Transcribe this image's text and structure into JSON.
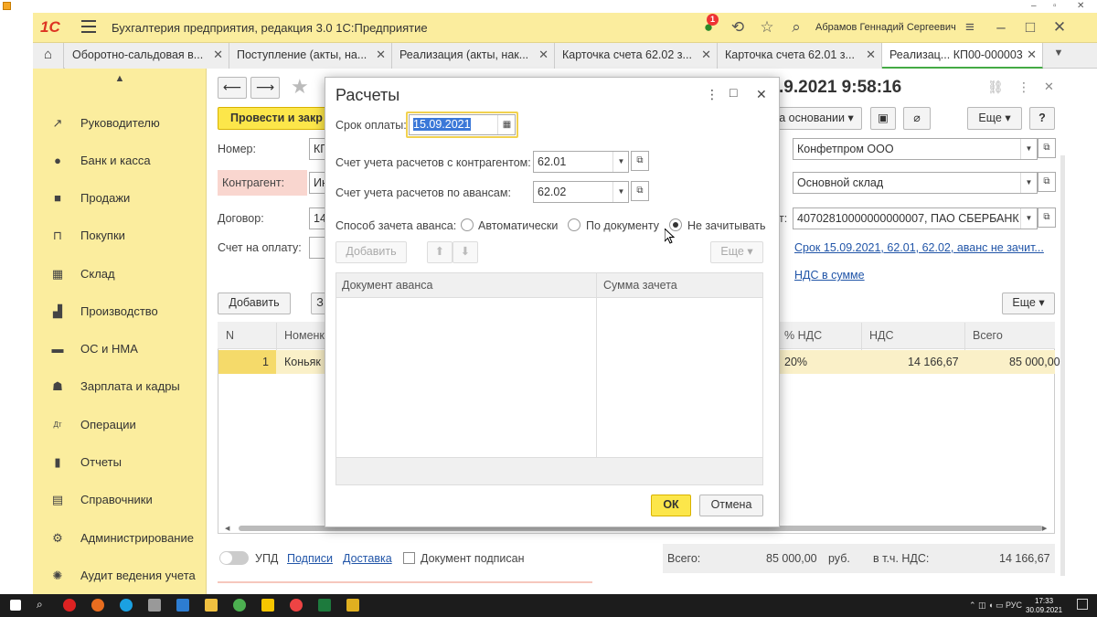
{
  "app": {
    "title": "Бухгалтерия предприятия, редакция 3.0 1С:Предприятие",
    "logo": "1С",
    "user": "Абрамов Геннадий Сергеевич",
    "notifications": "1"
  },
  "tabs": [
    {
      "label": "Оборотно-сальдовая в..."
    },
    {
      "label": "Поступление (акты, на..."
    },
    {
      "label": "Реализация (акты, нак..."
    },
    {
      "label": "Карточка счета 62.02 з..."
    },
    {
      "label": "Карточка счета 62.01 з..."
    },
    {
      "label": "Реализац...  КП00-000003"
    }
  ],
  "sidebar": {
    "items": [
      {
        "label": "Руководителю",
        "icon": "chart-icon"
      },
      {
        "label": "Банк и касса",
        "icon": "coin-icon"
      },
      {
        "label": "Продажи",
        "icon": "bag-icon"
      },
      {
        "label": "Покупки",
        "icon": "cart-icon"
      },
      {
        "label": "Склад",
        "icon": "warehouse-icon"
      },
      {
        "label": "Производство",
        "icon": "factory-icon"
      },
      {
        "label": "ОС и НМА",
        "icon": "truck-icon"
      },
      {
        "label": "Зарплата и кадры",
        "icon": "person-icon"
      },
      {
        "label": "Операции",
        "icon": "dt-kt-icon"
      },
      {
        "label": "Отчеты",
        "icon": "bar-chart-icon"
      },
      {
        "label": "Справочники",
        "icon": "book-icon"
      },
      {
        "label": "Администрирование",
        "icon": "gear-icon"
      },
      {
        "label": "Аудит ведения учета",
        "icon": "audit-icon"
      }
    ]
  },
  "document": {
    "title": ".9.2021 9:58:16",
    "post_close": "Провести и закр",
    "based_on": "а основании",
    "more": "Еще",
    "help": "?",
    "labels": {
      "number": "Номер:",
      "counterparty": "Контрагент:",
      "contract": "Договор:",
      "invoice": "Счет на оплату:",
      "bank_account_suffix": "т:"
    },
    "values": {
      "number": "КП",
      "counterparty": "Ин",
      "contract": "14",
      "organization": "Конфетпром ООО",
      "warehouse": "Основной склад",
      "bank_account": "40702810000000000007, ПАО СБЕРБАНК"
    },
    "links": {
      "settlement": "Срок 15.09.2021, 62.01, 62.02, аванс не зачит...",
      "vat": "НДС в сумме"
    },
    "add": "Добавить",
    "add2": "З",
    "grid": {
      "headers": [
        "N",
        "Номенк",
        "% НДС",
        "НДС",
        "Всего"
      ],
      "row": {
        "n": "1",
        "item": "Коньяк",
        "vat_rate": "20%",
        "vat": "14 166,67",
        "total": "85 000,00"
      }
    },
    "footer": {
      "upd": "УПД",
      "signatures": "Подписи",
      "delivery": "Доставка",
      "signed": "Документ подписан",
      "total_label": "Всего:",
      "total_value": "85 000,00",
      "currency": "руб.",
      "vat_label": "в т.ч. НДС:",
      "vat_value": "14 166,67"
    }
  },
  "modal": {
    "title": "Расчеты",
    "due_label": "Срок оплаты:",
    "due_value": "15.09.2021",
    "acc_label": "Счет учета расчетов с контрагентом:",
    "acc_value": "62.01",
    "adv_label": "Счет учета расчетов по авансам:",
    "adv_value": "62.02",
    "offset_label": "Способ зачета аванса:",
    "radio": [
      {
        "label": "Автоматически",
        "selected": false
      },
      {
        "label": "По документу",
        "selected": false
      },
      {
        "label": "Не зачитывать",
        "selected": true
      }
    ],
    "add": "Добавить",
    "more": "Еще",
    "grid_headers": [
      "Документ аванса",
      "Сумма зачета"
    ],
    "ok": "ОК",
    "cancel": "Отмена"
  },
  "taskbar": {
    "time": "17:33",
    "date": "30.09.2021",
    "lang": "РУС"
  },
  "colors": {
    "panel": "#fbed9e",
    "accent_button": "#fce64a",
    "link": "#2155a8"
  }
}
